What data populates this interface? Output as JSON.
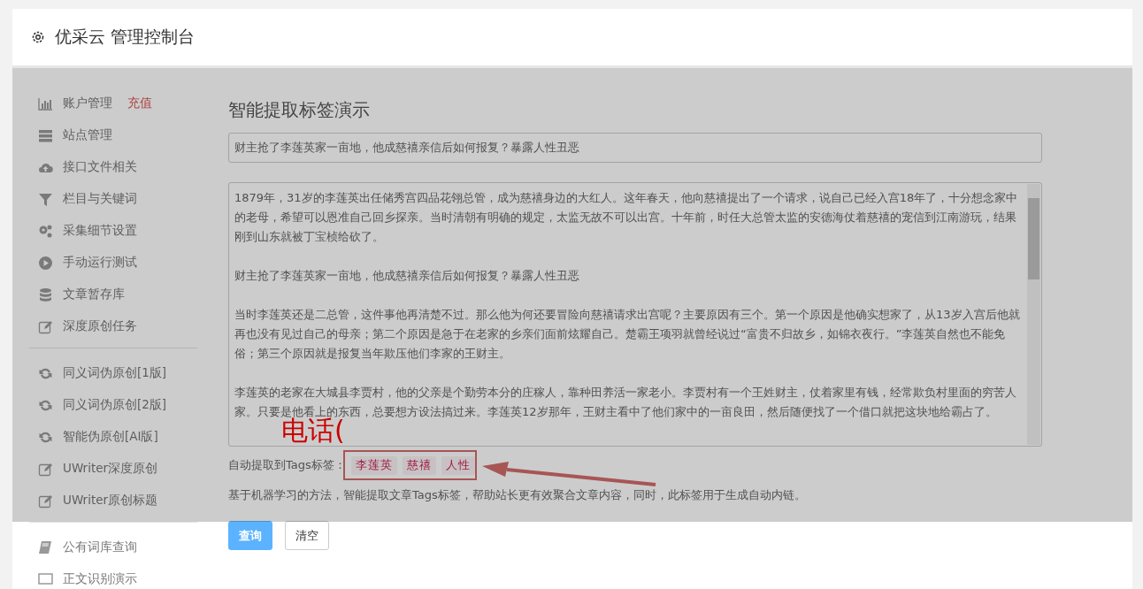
{
  "header": {
    "title": "优采云 管理控制台"
  },
  "sidebar": {
    "groups": [
      {
        "items": [
          {
            "kind": "bar-chart",
            "label": "账户管理",
            "badge": "充值"
          },
          {
            "kind": "server",
            "label": "站点管理"
          },
          {
            "kind": "cloud",
            "label": "接口文件相关"
          },
          {
            "kind": "filter",
            "label": "栏目与关键词"
          },
          {
            "kind": "gears",
            "label": "采集细节设置"
          },
          {
            "kind": "play",
            "label": "手动运行测试"
          },
          {
            "kind": "database",
            "label": "文章暂存库"
          },
          {
            "kind": "edit",
            "label": "深度原创任务"
          }
        ]
      },
      {
        "items": [
          {
            "kind": "refresh",
            "label": "同义词伪原创[1版]"
          },
          {
            "kind": "refresh",
            "label": "同义词伪原创[2版]"
          },
          {
            "kind": "refresh",
            "label": "智能伪原创[AI版]"
          },
          {
            "kind": "edit",
            "label": "UWriter深度原创"
          },
          {
            "kind": "edit",
            "label": "UWriter原创标题"
          }
        ]
      },
      {
        "items": [
          {
            "kind": "book",
            "label": "公有词库查询"
          },
          {
            "kind": "monitor",
            "label": "正文识别演示"
          }
        ]
      }
    ]
  },
  "main": {
    "heading": "智能提取标签演示",
    "title_field": {
      "value": "财主抢了李莲英家一亩地，他成慈禧亲信后如何报复？暴露人性丑恶"
    },
    "article": [
      "1879年，31岁的李莲英出任储秀宫四品花翎总管，成为慈禧身边的大红人。这年春天，他向慈禧提出了一个请求，说自己已经入宫18年了，十分想念家中的老母，希望可以恩准自己回乡探亲。当时清朝有明确的规定，太监无故不可以出宫。十年前，时任大总管太监的安德海仗着慈禧的宠信到江南游玩，结果刚到山东就被丁宝桢给砍了。",
      "财主抢了李莲英家一亩地，他成慈禧亲信后如何报复？暴露人性丑恶",
      "当时李莲英还是二总管，这件事他再清楚不过。那么他为何还要冒险向慈禧请求出宫呢？主要原因有三个。第一个原因是他确实想家了，从13岁入宫后他就再也没有见过自己的母亲；第二个原因是急于在老家的乡亲们面前炫耀自己。楚霸王项羽就曾经说过“富贵不归故乡，如锦衣夜行。”李莲英自然也不能免俗；第三个原因就是报复当年欺压他们李家的王财主。",
      "李莲英的老家在大城县李贾村，他的父亲是个勤劳本分的庄稼人，靠种田养活一家老小。李贾村有一个王姓财主，仗着家里有钱，经常欺负村里面的穷苦人家。只要是他看上的东西，总要想方设法搞过来。李莲英12岁那年，王财主看中了他们家中的一亩良田，然后随便找了一个借口就把这块地给霸占了。"
    ],
    "tags_label": "自动提取到Tags标签：",
    "tags": [
      "李莲英",
      "慈禧",
      "人性"
    ],
    "description": "基于机器学习的方法，智能提取文章Tags标签，帮助站长更有效聚合文章内容，同时，此标签用于生成自动内链。",
    "buttons": [
      {
        "kind": "primary",
        "label": "查询"
      },
      {
        "kind": "default",
        "label": "清空"
      }
    ]
  },
  "annotation": {
    "text": "电话("
  }
}
